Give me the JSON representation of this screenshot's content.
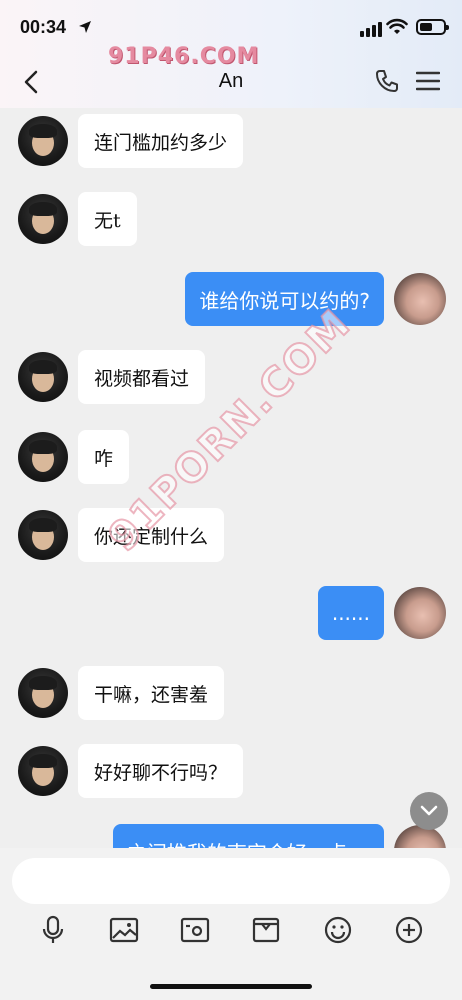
{
  "status": {
    "time": "00:34"
  },
  "header": {
    "title": "An",
    "watermark": "91P46.COM"
  },
  "watermark_diag": "91PORN.COM",
  "messages": [
    {
      "side": "in",
      "text": "连门槛加约多少"
    },
    {
      "side": "in",
      "text": "无t"
    },
    {
      "side": "out",
      "text": "谁给你说可以约的?"
    },
    {
      "side": "in",
      "text": "视频都看过"
    },
    {
      "side": "in",
      "text": "咋"
    },
    {
      "side": "in",
      "text": "你还定制什么"
    },
    {
      "side": "out",
      "text": "......"
    },
    {
      "side": "in",
      "text": "干嘛，还害羞"
    },
    {
      "side": "in",
      "text": "好好聊不行吗？"
    },
    {
      "side": "out",
      "text": "之间推我的南宫会好一点 ✏"
    }
  ],
  "input": {
    "value": "",
    "placeholder": ""
  },
  "toolbar": {
    "icons": [
      "microphone-icon",
      "image-icon",
      "camera-icon",
      "box-icon",
      "emoji-icon",
      "plus-icon"
    ]
  }
}
